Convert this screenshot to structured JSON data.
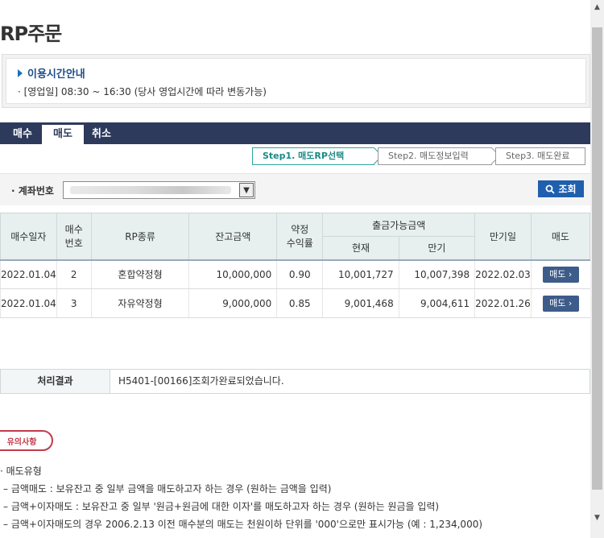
{
  "title": "RP주문",
  "info": {
    "heading": "이용시간안내",
    "text": "· [영업일] 08:30 ~ 16:30 (당사 영업시간에 따라 변동가능)"
  },
  "tabs": [
    "매수",
    "매도",
    "취소"
  ],
  "steps": [
    "Step1. 매도RP선택",
    "Step2. 매도정보입력",
    "Step3. 매도완료"
  ],
  "account": {
    "label": "· 계좌번호",
    "inquire": "조회"
  },
  "table": {
    "headers": {
      "buy_date": "매수일자",
      "buy_no": "매수\n번호",
      "rp_type": "RP종류",
      "balance": "잔고금액",
      "rate": "약정\n수익률",
      "withdraw": "출금가능금액",
      "current": "현재",
      "maturity_amt": "만기",
      "maturity_date": "만기일",
      "sell": "매도"
    },
    "rows": [
      {
        "buy_date": "2022.01.04",
        "buy_no": "2",
        "rp_type": "혼합약정형",
        "balance": "10,000,000",
        "rate": "0.90",
        "current": "10,001,727",
        "maturity_amt": "10,007,398",
        "maturity_date": "2022.02.03",
        "sell": "매도 ›"
      },
      {
        "buy_date": "2022.01.04",
        "buy_no": "3",
        "rp_type": "자유약정형",
        "balance": "9,000,000",
        "rate": "0.85",
        "current": "9,001,468",
        "maturity_amt": "9,004,611",
        "maturity_date": "2022.01.26",
        "sell": "매도 ›"
      }
    ]
  },
  "result": {
    "label": "처리결과",
    "value": "H5401-[00166]조회가완료되었습니다."
  },
  "notice": {
    "badge": "유의사항",
    "lines": [
      "· 매도유형",
      "– 금액매도 : 보유잔고 중 일부 금액을 매도하고자 하는 경우 (원하는 금액을 입력)",
      "– 금액+이자매도 : 보유잔고 중 일부 '원금+원금에 대한 이자'를 매도하고자 하는 경우 (원하는 원금을 입력)",
      "– 금액+이자매도의 경우 2006.2.13 이전 매수분의 매도는 천원이하 단위를 '000'으로만 표시가능 (예 : 1,234,000)"
    ]
  }
}
